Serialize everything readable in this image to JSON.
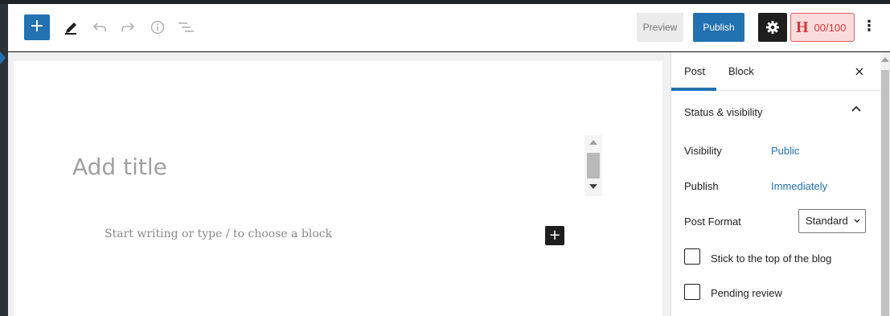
{
  "toolbar": {
    "add_label": "+",
    "preview_label": "Preview",
    "publish_label": "Publish",
    "score_letter": "H",
    "score_value": "00/100",
    "more_label": "⋮",
    "icons": [
      "edit-icon",
      "undo-icon",
      "redo-icon",
      "info-icon",
      "list-view-icon",
      "settings-gear-icon"
    ]
  },
  "editor": {
    "title_placeholder": "Add title",
    "block_placeholder": "Start writing or type / to choose a block",
    "inline_add_label": "+"
  },
  "sidebar": {
    "tabs": [
      {
        "label": "Post",
        "active": true
      },
      {
        "label": "Block",
        "active": false
      }
    ],
    "close_label": "×",
    "panel": {
      "title": "Status & visibility",
      "rows": [
        {
          "label": "Visibility",
          "value": "Public"
        },
        {
          "label": "Publish",
          "value": "Immediately"
        }
      ],
      "post_format": {
        "label": "Post Format",
        "selected": "Standard"
      },
      "checkboxes": [
        {
          "label": "Stick to the top of the blog",
          "checked": false
        },
        {
          "label": "Pending review",
          "checked": false
        }
      ]
    }
  },
  "colors": {
    "accent": "#2271b1",
    "score_bg": "#fbdcdc",
    "score_text": "#d63638",
    "dark": "#1e1e1e"
  }
}
